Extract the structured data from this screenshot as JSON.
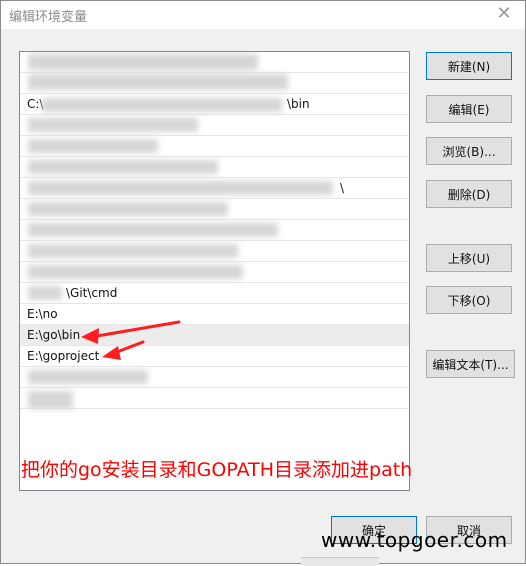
{
  "window": {
    "title": "编辑环境变量",
    "close_icon": "✕"
  },
  "list": {
    "rows": [
      {
        "text": "",
        "selected": false
      },
      {
        "text": "",
        "selected": false
      },
      {
        "text": "C:\\",
        "tail": "\\bin",
        "selected": false
      },
      {
        "text": "",
        "selected": false
      },
      {
        "text": "",
        "selected": false
      },
      {
        "text": "",
        "selected": false
      },
      {
        "text": "",
        "tail": "\\",
        "selected": false
      },
      {
        "text": "",
        "selected": false
      },
      {
        "text": "",
        "selected": false
      },
      {
        "text": "",
        "selected": false
      },
      {
        "text": "",
        "selected": false
      },
      {
        "text": "\\Git\\cmd",
        "selected": false
      },
      {
        "text": "E:\\no",
        "selected": false
      },
      {
        "text": "E:\\go\\bin",
        "selected": true
      },
      {
        "text": "E:\\goproject",
        "selected": false
      },
      {
        "text": "",
        "selected": false
      },
      {
        "text": "",
        "selected": false
      }
    ]
  },
  "buttons": {
    "new": "新建(N)",
    "edit": "编辑(E)",
    "browse": "浏览(B)...",
    "delete": "删除(D)",
    "move_up": "上移(U)",
    "move_down": "下移(O)",
    "edit_text": "编辑文本(T)...",
    "ok": "确定",
    "cancel": "取消"
  },
  "annotation": {
    "text": "把你的go安装目录和GOPATH目录添加进path",
    "color": "#ff0000"
  },
  "watermark": {
    "text": "www.topgoer.com"
  }
}
